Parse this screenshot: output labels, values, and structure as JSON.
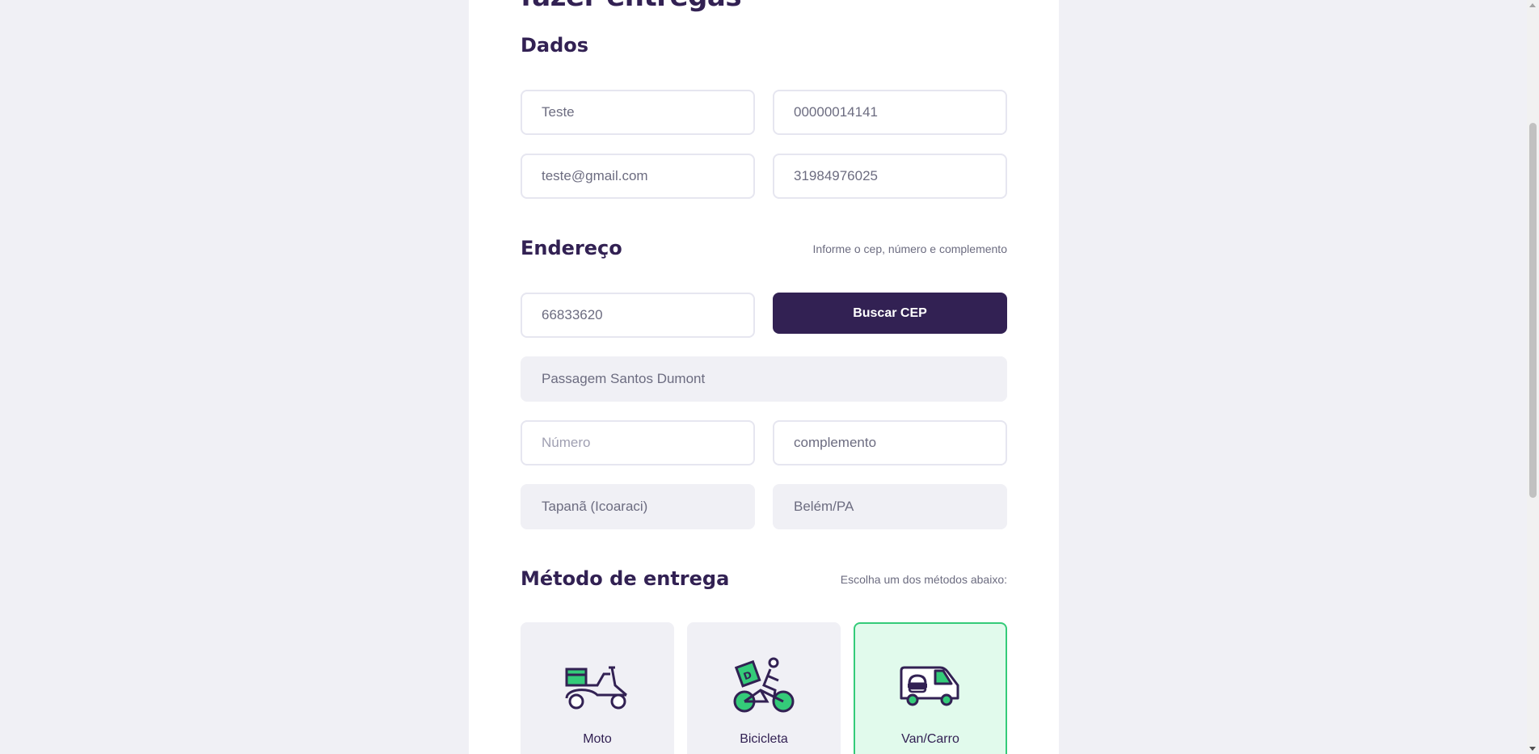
{
  "form": {
    "title": "fazer entregas"
  },
  "dados": {
    "legend": "Dados",
    "name_value": "Teste",
    "document_value": "00000014141",
    "email_value": "teste@gmail.com",
    "phone_value": "31984976025"
  },
  "endereco": {
    "legend": "Endereço",
    "hint": "Informe o cep, número e complemento",
    "cep_value": "66833620",
    "search_button": "Buscar CEP",
    "street_value": "Passagem Santos Dumont",
    "number_placeholder": "Número",
    "complement_value": "complemento",
    "neighborhood_value": "Tapanã (Icoaraci)",
    "city_value": "Belém/PA"
  },
  "metodo": {
    "legend": "Método de entrega",
    "hint": "Escolha um dos métodos abaixo:",
    "options": [
      {
        "label": "Moto",
        "icon": "scooter-icon",
        "selected": false
      },
      {
        "label": "Bicicleta",
        "icon": "bicycle-icon",
        "selected": false
      },
      {
        "label": "Van/Carro",
        "icon": "van-icon",
        "selected": true
      }
    ]
  },
  "colors": {
    "primary": "#322153",
    "accent": "#34cb79",
    "selected_bg": "#e1faec",
    "page_bg": "#f0f0f5"
  }
}
